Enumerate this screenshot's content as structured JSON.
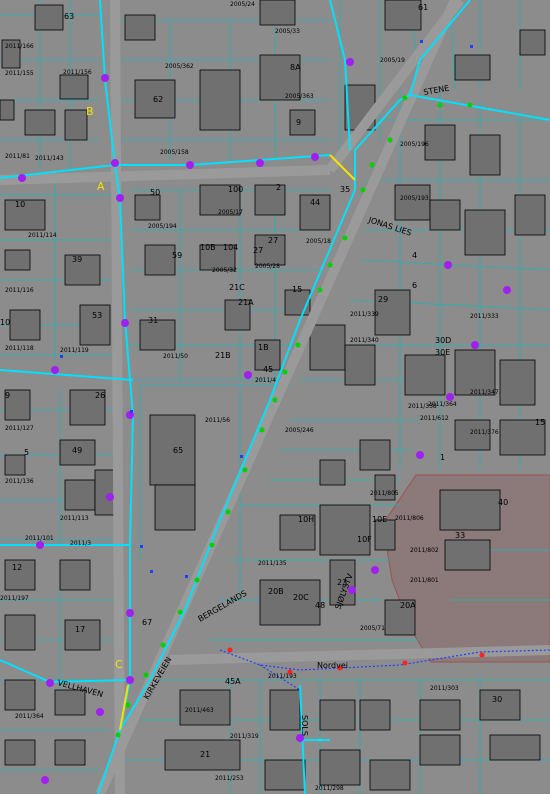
{
  "colors": {
    "background": "#8c8c8c",
    "property_line": "#00e5e5",
    "cable": "#00e0ff",
    "building_fill": "#707070",
    "highlight_zone": "#8c7a7a",
    "node": "#a020f0",
    "green_node": "#00d000",
    "red_node": "#ff2020",
    "yellow_segment": "#f4e200"
  },
  "streets": [
    {
      "id": "jonas",
      "label": "JONAS LIES"
    },
    {
      "id": "kirkeveien",
      "label": "KIRKEVEIEN"
    },
    {
      "id": "bergelandsg",
      "label": "BERGELANDS"
    },
    {
      "id": "sjolystvei",
      "label": "SJØLYSTV"
    },
    {
      "id": "nordeveien",
      "label": "Nordvei"
    },
    {
      "id": "vellhaven",
      "label": "VELLHAVEN"
    },
    {
      "id": "sols",
      "label": "SOLS"
    },
    {
      "id": "stene",
      "label": "STENE"
    }
  ],
  "point_labels": [
    {
      "id": "A",
      "text": "A"
    },
    {
      "id": "B",
      "text": "B"
    },
    {
      "id": "C",
      "text": "C"
    }
  ],
  "house_numbers": [
    "63",
    "61",
    "62",
    "50",
    "8A",
    "9",
    "100",
    "2",
    "44",
    "35",
    "59",
    "104",
    "27",
    "10B",
    "10",
    "39",
    "15",
    "6",
    "21A",
    "53",
    "31",
    "21B",
    "1B",
    "27",
    "45",
    "65",
    "12",
    "10",
    "9",
    "17",
    "4",
    "10H",
    "10F",
    "10E",
    "23",
    "20A",
    "20B",
    "20C",
    "48",
    "40",
    "45A",
    "33",
    "29",
    "26",
    "15",
    "21",
    "30",
    "1",
    "67",
    "49",
    "5",
    "21C",
    "30E",
    "30D"
  ],
  "parcel_labels": [
    "2005/24",
    "2005/33",
    "2011/166",
    "2011/143",
    "2005/362",
    "2005/363",
    "2011/81",
    "2005/158",
    "2005/19",
    "2011/156",
    "2011/155",
    "2005/193",
    "2011/114",
    "2005/32",
    "2005/194",
    "2011/116",
    "2011/118",
    "2011/119",
    "2011/127",
    "2011/136",
    "2011/56",
    "2011/101",
    "2011/113",
    "2005/246",
    "2011/50",
    "2011/4",
    "2011/3",
    "2011/197",
    "2011/135",
    "2011/801",
    "2011/802",
    "2005/71",
    "2011/193",
    "2011/253",
    "2011/463",
    "2011/364",
    "2011/303",
    "2011/298",
    "2011/333",
    "2011/347",
    "2005/196",
    "2005/17",
    "2005/18",
    "2005/28",
    "2011/339",
    "2011/340",
    "2011/338",
    "2011/319",
    "2011/364",
    "2011/376",
    "2011/805",
    "2011/806",
    "2011/612"
  ]
}
